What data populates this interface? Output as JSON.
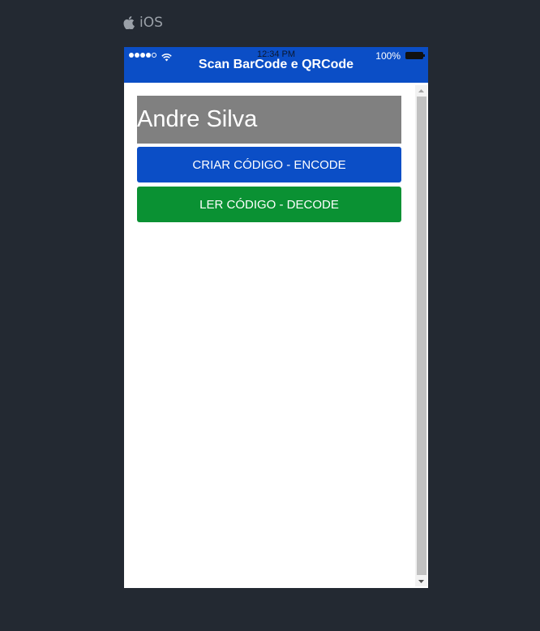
{
  "platform": {
    "icon": "apple-icon",
    "label": "iOS"
  },
  "status_bar": {
    "time": "12:34 PM",
    "battery_percent": "100%",
    "signal_icon": "signal-dots-icon",
    "wifi_icon": "wifi-icon",
    "battery_icon": "battery-icon"
  },
  "navbar": {
    "title": "Scan BarCode e QRCode"
  },
  "main": {
    "name_label": "Andre Silva",
    "encode_button": "CRIAR CÓDIGO - ENCODE",
    "decode_button": "LER CÓDIGO - DECODE"
  },
  "colors": {
    "background": "#232932",
    "navbar": "#0b4ec6",
    "encode_button": "#0b4ec6",
    "decode_button": "#0a9133",
    "name_box": "#808080"
  }
}
